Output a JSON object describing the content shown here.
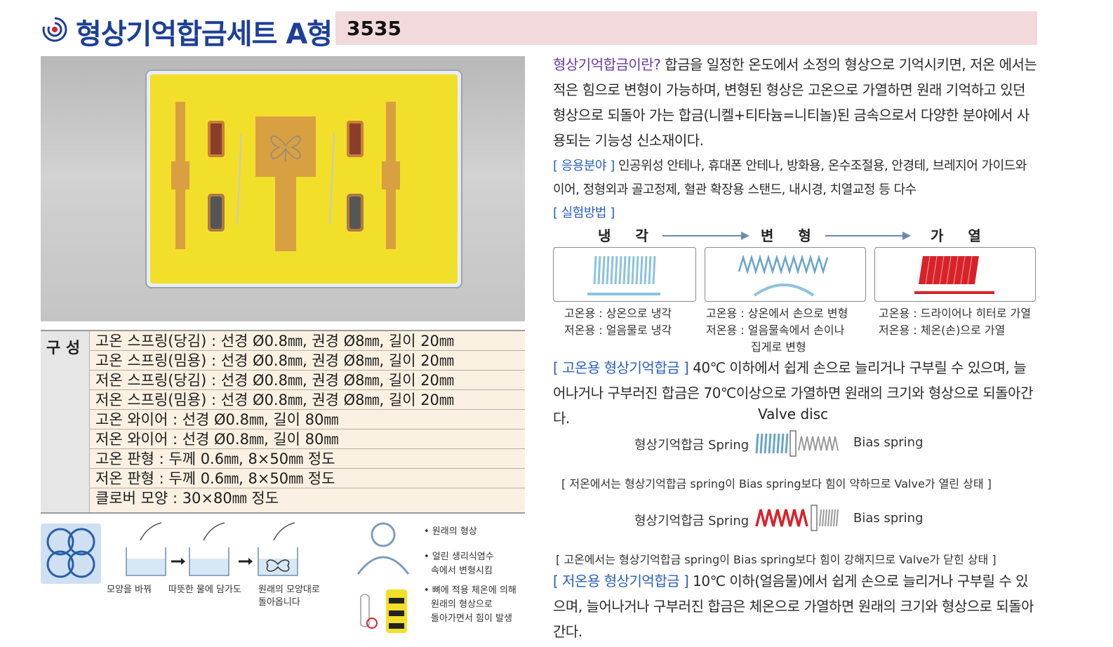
{
  "header": {
    "title": "형상기억합금세트 A형",
    "code": "3535"
  },
  "composition": {
    "heading": "구 성",
    "rows": [
      "고온 스프링(당김) : 선경 Ø0.8㎜, 권경 Ø8㎜, 길이 20㎜",
      "고온 스프링(밈용) : 선경 Ø0.8㎜, 권경 Ø8㎜, 길이 20㎜",
      "저온 스프링(당김) : 선경 Ø0.8㎜, 권경 Ø8㎜, 길이 20㎜",
      "저온 스프링(밈용) : 선경 Ø0.8㎜, 권경 Ø8㎜, 길이 20㎜",
      "고온 와이어 : 선경 Ø0.8㎜, 길이 80㎜",
      "저온 와이어 : 선경 Ø0.8㎜, 길이 80㎜",
      "고온 판형 : 두께 0.6㎜, 8×50㎜ 정도",
      "저온 판형 : 두께 0.6㎜, 8×50㎜ 정도",
      "클로버 모양 : 30×80㎜ 정도"
    ]
  },
  "steps": {
    "cap1": "모양을 바꿔",
    "cap2": "따뜻한 물에 담가도",
    "cap3a": "원래의 모양대로",
    "cap3b": "돌아옵니다"
  },
  "side_notes": {
    "n1": "• 원래의 형상",
    "n2a": "• 얼린 생리식염수",
    "n2b": "속에서 변형시킴",
    "n3a": "• 뼈에 적용 체온에 의해",
    "n3b": "원래의 형상으로",
    "n3c": "돌아가면서 힘이 발생"
  },
  "intro": {
    "term": "형상기억합금이란?",
    "text": " 합금을 일정한 온도에서 소정의 형상으로 기억시키면, 저온 에서는 적은 힘으로 변형이 가능하며, 변형된 형상은 고온으로 가열하면 원래 기억하고 있던 형상으로 되돌아 가는 합금(니켈+티타늄=니티놀)된 금속으로서 다양한 분야에서 사용되는 기능성 신소재이다."
  },
  "application": {
    "label": "[ 응용분야 ]",
    "text": " 인공위성 안테나, 휴대폰 안테나, 방화용, 온수조절용, 안경테, 브레지어 가이드와이어, 정형외과 골고정제, 혈관 확장용 스탠드, 내시경, 치열교정 등 다수"
  },
  "method": {
    "label": "[ 실험방법 ]",
    "stages": [
      "냉 각",
      "변 형",
      "가 열"
    ],
    "captions": {
      "cool_1": "고온용 : 상온으로 냉각",
      "cool_2": "저온용 : 얼음물로 냉각",
      "deform_1": "고온용 : 상온에서 손으로 변형",
      "deform_2": "저온용 : 얼음물속에서 손이나",
      "deform_3": "집게로 변형",
      "heat_1": "고온용 : 드라이어나 히터로 가열",
      "heat_2": "저온용 : 체온(손)으로 가열"
    }
  },
  "high_temp": {
    "label": "[ 고온용 형상기억합금 ]",
    "text": " 40℃ 이하에서 쉽게 손으로 늘리거나 구부릴 수 있으며, 늘어나거나 구부러진 합금은 70℃이상으로 가열하면 원래의 크기와 형상으로 되돌아간다."
  },
  "valve": {
    "title": "Valve disc",
    "left_label": "형상기억합금 Spring",
    "right_label": "Bias spring",
    "note_open": "[ 저온에서는 형상기억합금 spring이 Bias spring보다 힘이 약하므로 Valve가 열린 상태 ]",
    "note_closed": "[ 고온에서는 형상기억합금 spring이 Bias spring보다 힘이 강해지므로 Valve가 닫힌 상태 ]"
  },
  "low_temp": {
    "label": "[ 저온용 형상기억합금 ]",
    "text": " 10℃ 이하(얼음물)에서 쉽게 손으로 늘리거나 구부릴 수 있으며, 늘어나거나 구부러진 합금은 체온으로 가열하면 원래의 크기와 형상으로 되돌아간다."
  },
  "colors": {
    "title_blue": "#1d3f97",
    "code_bar": "#f2d9dc",
    "tray_yellow": "#f2df2a",
    "label_blue": "#2a5fc0",
    "heat_red": "#d8222a",
    "cool_blue": "#8cc2e0"
  }
}
